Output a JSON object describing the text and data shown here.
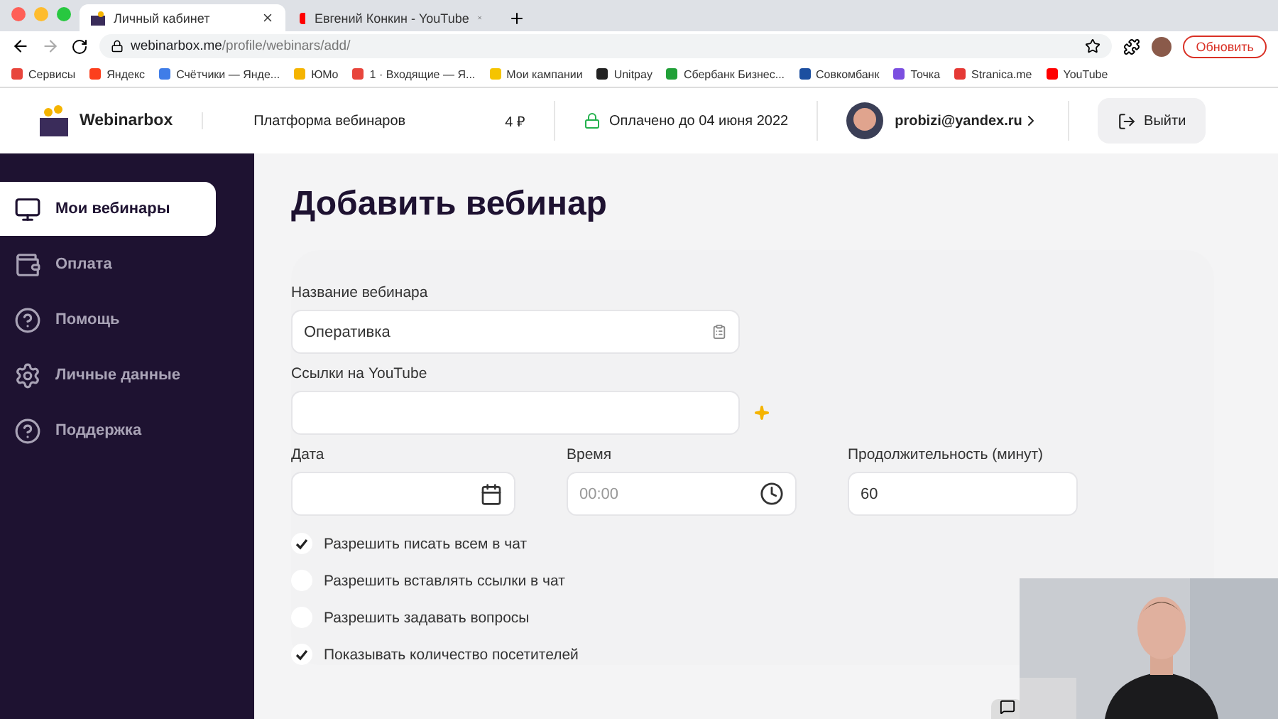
{
  "browser": {
    "tabs": [
      {
        "title": "Личный кабинет",
        "selected": true,
        "kind": "logo"
      },
      {
        "title": "Евгений Конкин - YouTube",
        "selected": false,
        "kind": "video"
      }
    ],
    "url": {
      "host": "webinarbox.me",
      "path": "/profile/webinars/add/"
    },
    "update_button": "Обновить",
    "bookmarks": [
      {
        "label": "Сервисы",
        "color": "#e8453c"
      },
      {
        "label": "Яндекс",
        "color": "#fc3f1d"
      },
      {
        "label": "Счётчики — Янде...",
        "color": "#3f7de8"
      },
      {
        "label": "ЮMo",
        "color": "#f5b400"
      },
      {
        "label": "1 · Входящие — Я...",
        "color": "#e8453c"
      },
      {
        "label": "Мои кампании",
        "color": "#f5c400"
      },
      {
        "label": "Unitpay",
        "color": "#222222"
      },
      {
        "label": "Сбербанк Бизнес...",
        "color": "#21a038"
      },
      {
        "label": "Совкомбанк",
        "color": "#1c4fa0"
      },
      {
        "label": "Точка",
        "color": "#7b4fe0"
      },
      {
        "label": "Stranica.me",
        "color": "#e53935"
      },
      {
        "label": "YouTube",
        "color": "#ff0000"
      }
    ]
  },
  "header": {
    "brand": "Webinarbox",
    "tagline": "Платформа вебинаров",
    "balance": "4 ₽",
    "paid": "Оплачено до 04 июня 2022",
    "email": "probizi@yandex.ru",
    "logout": "Выйти"
  },
  "sidebar": {
    "items": [
      {
        "label": "Мои вебинары",
        "kind": "monitor",
        "selected": true
      },
      {
        "label": "Оплата",
        "kind": "wallet",
        "selected": false
      },
      {
        "label": "Помощь",
        "kind": "help",
        "selected": false
      },
      {
        "label": "Личные данные",
        "kind": "gear",
        "selected": false
      },
      {
        "label": "Поддержка",
        "kind": "help",
        "selected": false
      }
    ]
  },
  "page": {
    "title": "Добавить вебинар",
    "name_field": {
      "label": "Название вебинара",
      "value": "Оперативка"
    },
    "youtube_field": {
      "label": "Ссылки на YouTube"
    },
    "date_field": {
      "label": "Дата"
    },
    "time_field": {
      "label": "Время",
      "placeholder": "00:00"
    },
    "duration_field": {
      "label": "Продолжительность (минут)",
      "value": "60"
    },
    "options": [
      {
        "label": "Разрешить писать всем в чат",
        "checked": true
      },
      {
        "label": "Разрешить вставлять ссылки в чат",
        "checked": false
      },
      {
        "label": "Разрешить задавать вопросы",
        "checked": false
      },
      {
        "label": "Показывать количество посетителей",
        "checked": true
      }
    ]
  }
}
